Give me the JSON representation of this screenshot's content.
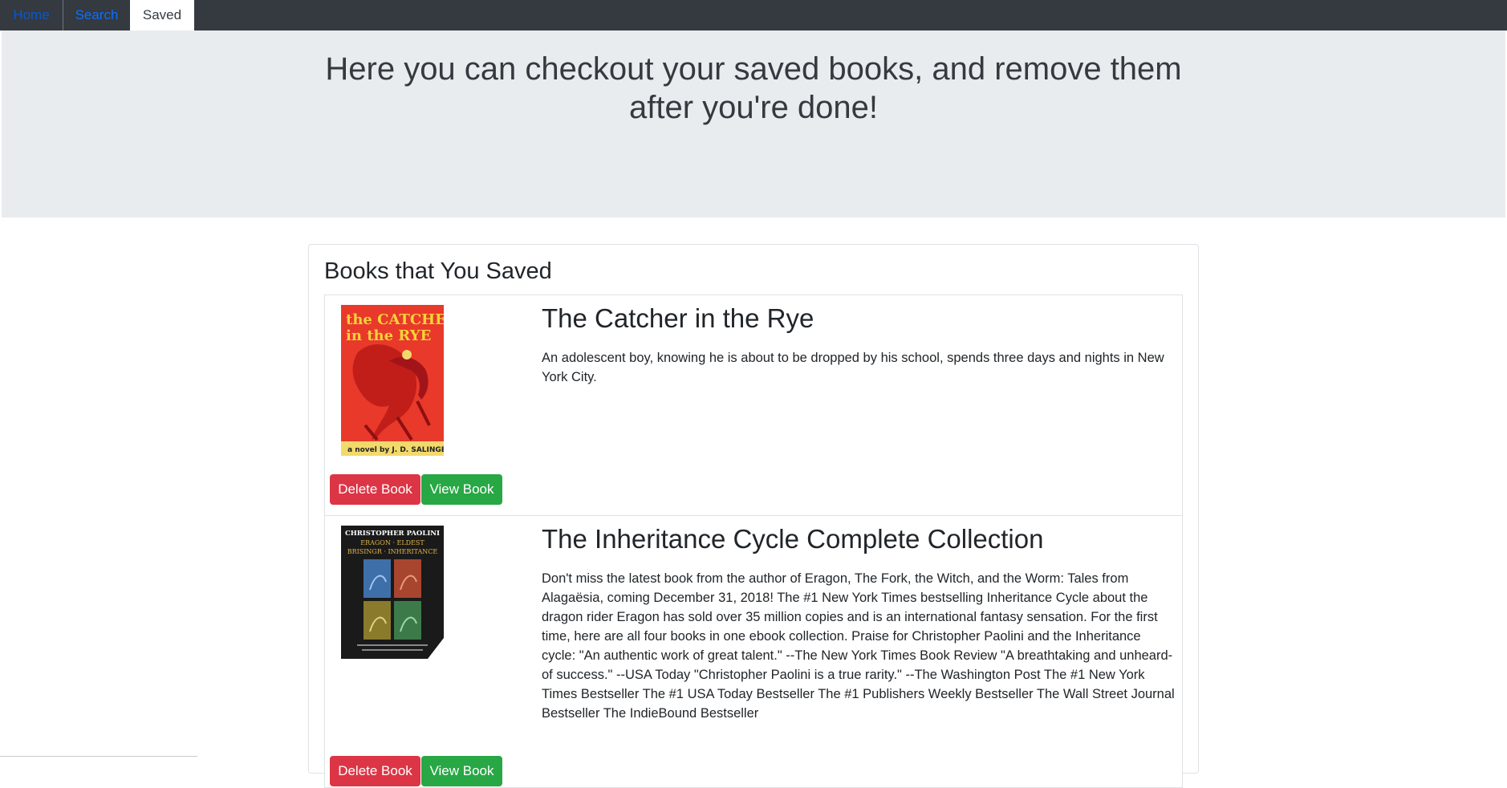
{
  "nav": {
    "tabs": [
      {
        "label": "Home"
      },
      {
        "label": "Search"
      },
      {
        "label": "Saved"
      }
    ]
  },
  "hero": {
    "title": "Here you can checkout your saved books, and remove them after you're done!"
  },
  "saved": {
    "heading": "Books that You Saved",
    "books": [
      {
        "title": "The Catcher in the Rye",
        "description": "An adolescent boy, knowing he is about to be dropped by his school, spends three days and nights in New York City.",
        "cover_text": {
          "title_line1": "the CATCHER",
          "title_line2": "in the RYE",
          "author": "a novel by J. D. SALINGER"
        },
        "delete_label": "Delete Book",
        "view_label": "View Book"
      },
      {
        "title": "The Inheritance Cycle Complete Collection",
        "description": "Don't miss the latest book from the author of Eragon, The Fork, the Witch, and the Worm: Tales from Alagaësia, coming December 31, 2018! The #1 New York Times bestselling Inheritance Cycle about the dragon rider Eragon has sold over 35 million copies and is an international fantasy sensation. For the first time, here are all four books in one ebook collection. Praise for Christopher Paolini and the Inheritance cycle: \"An authentic work of great talent.\" --The New York Times Book Review \"A breathtaking and unheard-of success.\" --USA Today \"Christopher Paolini is a true rarity.\" --The Washington Post The #1 New York Times Bestseller The #1 USA Today Bestseller The #1 Publishers Weekly Bestseller The Wall Street Journal Bestseller The IndieBound Bestseller",
        "cover_text": {
          "author": "CHRISTOPHER PAOLINI",
          "line1": "ERAGON · ELDEST",
          "line2": "BRISINGR · INHERITANCE"
        },
        "delete_label": "Delete Book",
        "view_label": "View Book"
      }
    ]
  },
  "colors": {
    "navbar": "#343a40",
    "jumbotron": "#e9ecef",
    "danger": "#dc3545",
    "success": "#28a745",
    "link": "#0d6efd"
  }
}
